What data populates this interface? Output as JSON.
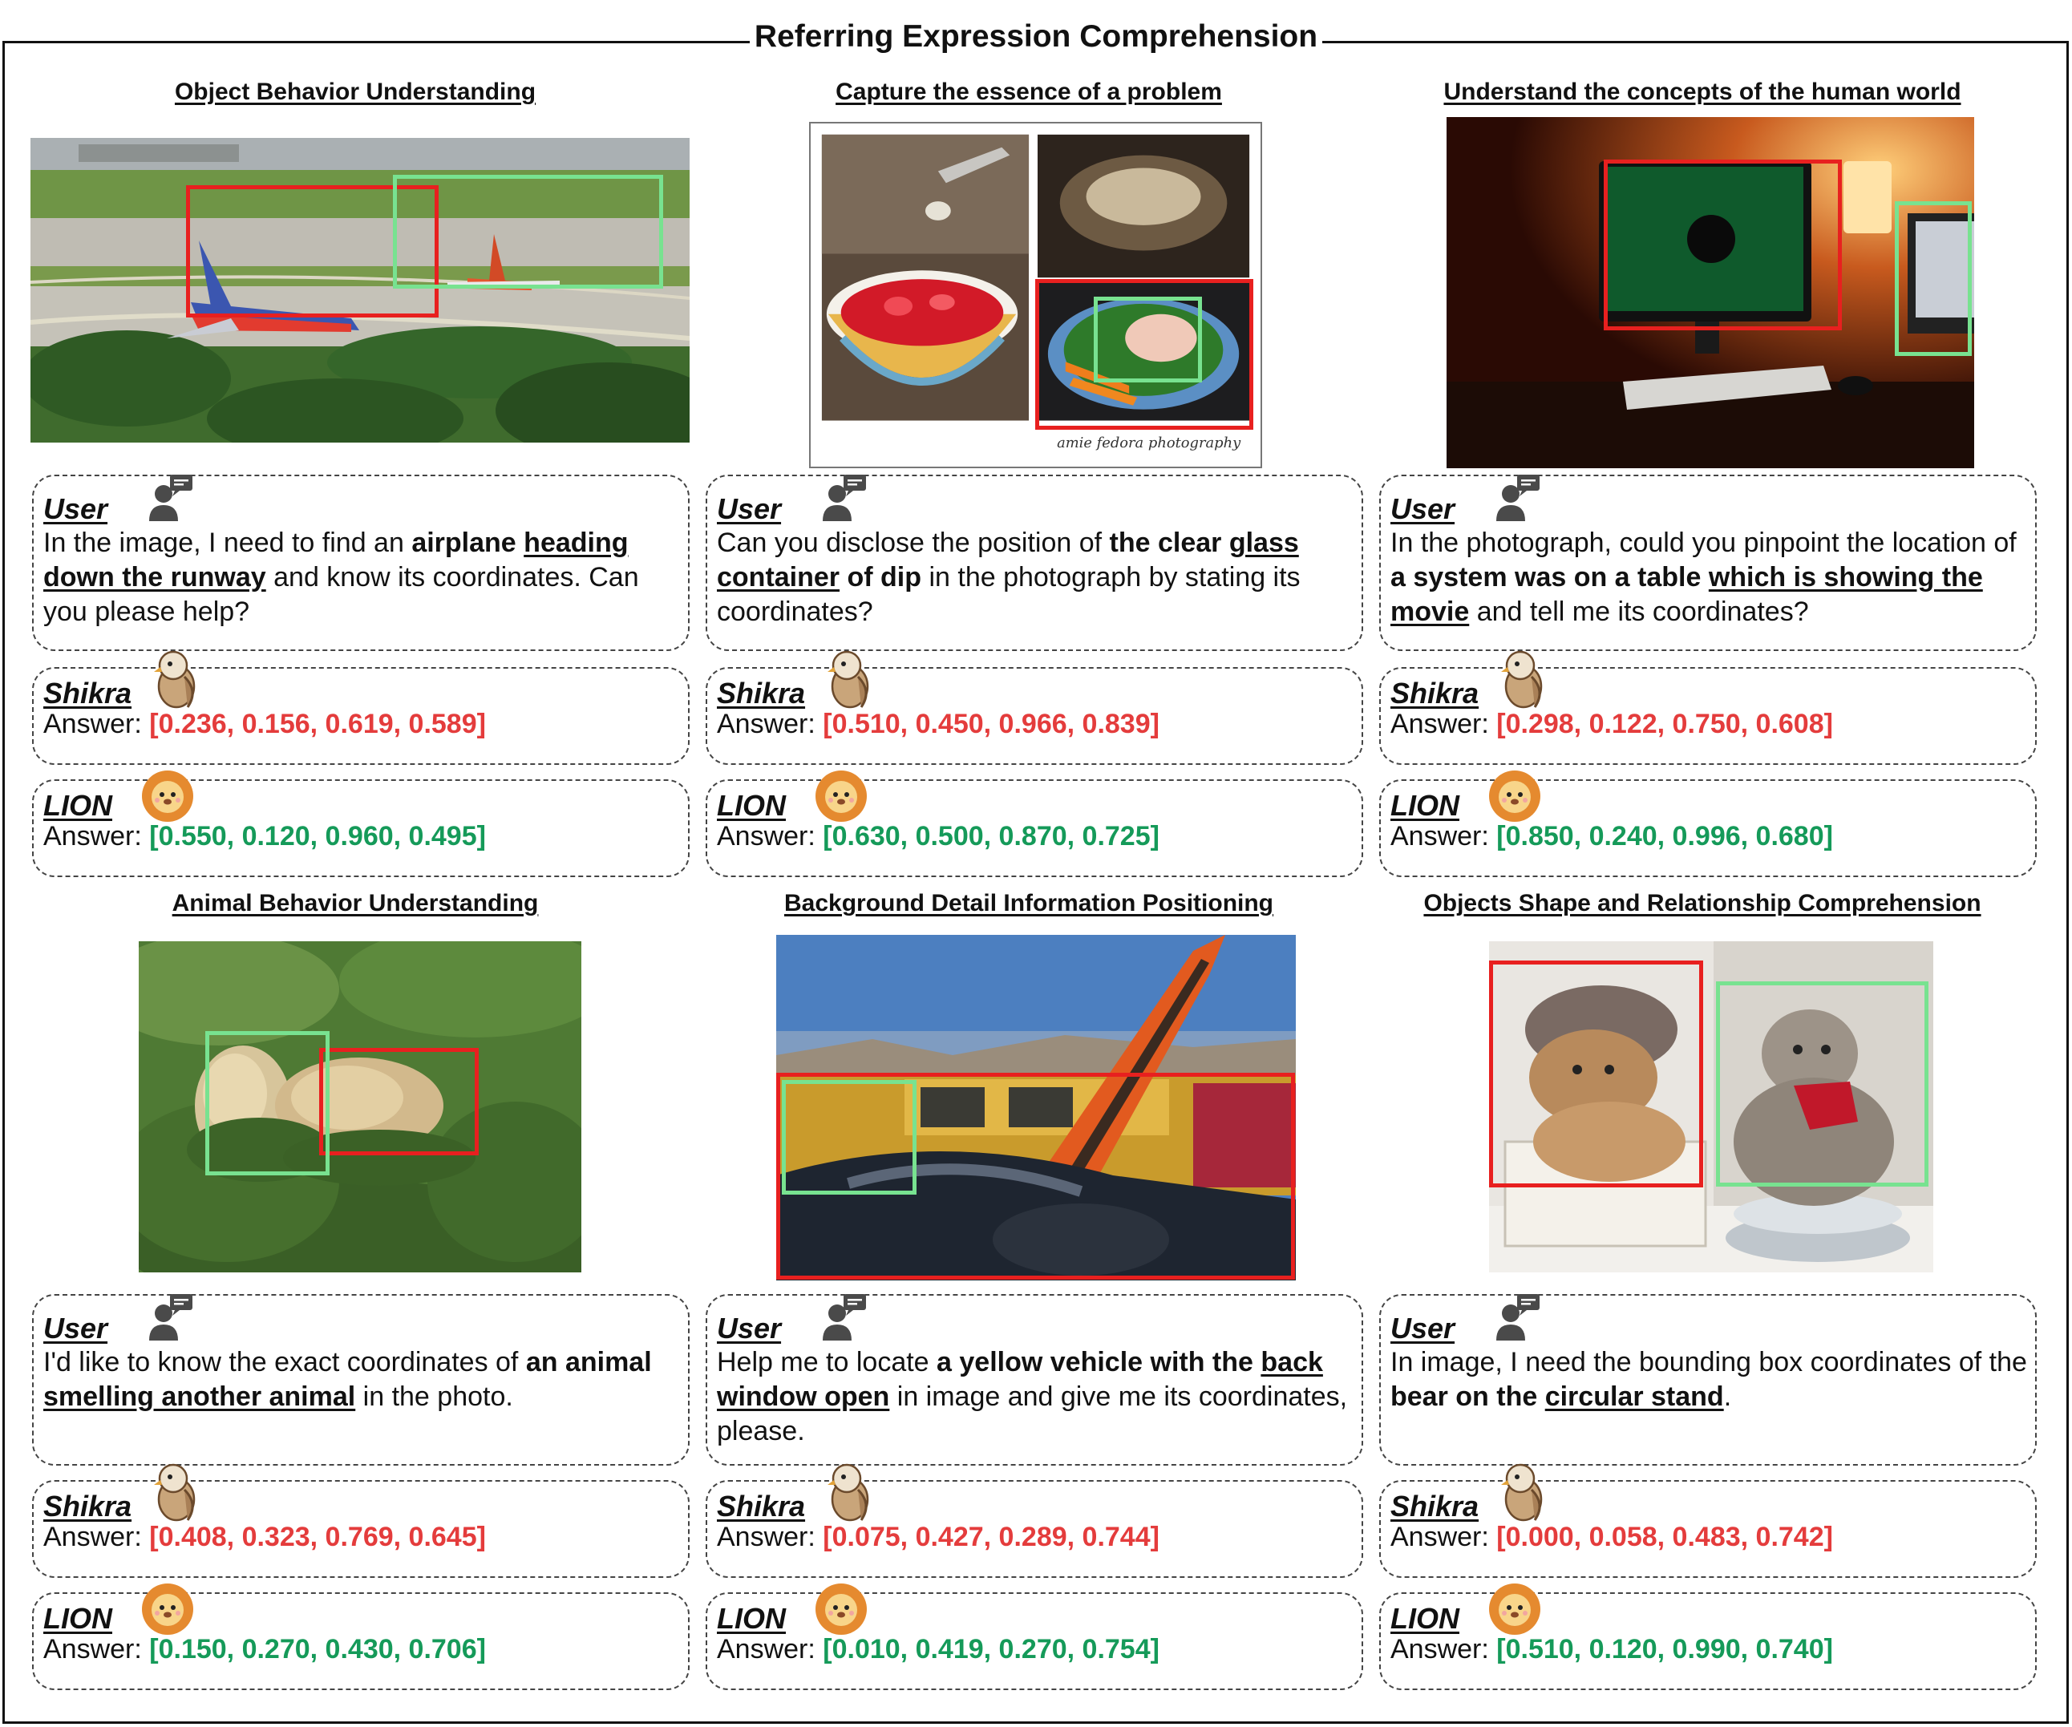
{
  "title": "Referring Expression Comprehension",
  "labels": {
    "user": "User",
    "shikra": "Shikra",
    "lion": "LION",
    "answer_prefix": "Answer:"
  },
  "colors": {
    "shikra_box": "#e8201f",
    "lion_box": "#78e290",
    "shikra_text": "#e43c3c",
    "lion_text": "#159a59"
  },
  "panels": [
    {
      "heading": "Object Behavior Understanding",
      "image": "airport-airplanes-photo",
      "question": [
        {
          "t": "In the image, I need to find an "
        },
        {
          "t": "airplane",
          "b": true
        },
        {
          "t": " "
        },
        {
          "t": "heading down the runway",
          "b": true,
          "u": true
        },
        {
          "t": " and know its coordinates. Can you please help?"
        }
      ],
      "shikra_answer": "[0.236, 0.156, 0.619, 0.589]",
      "lion_answer": "[0.550, 0.120, 0.960, 0.495]"
    },
    {
      "heading": "Capture the essence of a problem",
      "image": "food-collage-photo",
      "watermark": "amie fedora photography",
      "question": [
        {
          "t": "Can you disclose the position of "
        },
        {
          "t": "the clear ",
          "b": true
        },
        {
          "t": "glass container",
          "b": true,
          "u": true
        },
        {
          "t": " of dip",
          "b": true
        },
        {
          "t": " in the photograph by stating its coordinates?"
        }
      ],
      "shikra_answer": "[0.510, 0.450, 0.966, 0.839]",
      "lion_answer": "[0.630, 0.500, 0.870, 0.725]"
    },
    {
      "heading": "Understand the concepts of the human world",
      "image": "computer-desk-photo",
      "question": [
        {
          "t": "In the photograph, could you pinpoint the location of "
        },
        {
          "t": "a system was on a table ",
          "b": true
        },
        {
          "t": "which is showing the movie",
          "b": true,
          "u": true
        },
        {
          "t": " and tell me its coordinates?"
        }
      ],
      "shikra_answer": "[0.298, 0.122, 0.750, 0.608]",
      "lion_answer": "[0.850, 0.240, 0.996, 0.680]"
    },
    {
      "heading": "Animal Behavior Understanding",
      "image": "bears-in-bushes-photo",
      "question": [
        {
          "t": "I'd like to know the exact coordinates of "
        },
        {
          "t": "an animal",
          "b": true
        },
        {
          "t": " "
        },
        {
          "t": "smelling another animal",
          "b": true,
          "u": true
        },
        {
          "t": " in the photo."
        }
      ],
      "shikra_answer": "[0.408, 0.323, 0.769, 0.645]",
      "lion_answer": "[0.150, 0.270, 0.430, 0.706]"
    },
    {
      "heading": "Background Detail Information Positioning",
      "image": "surfboard-cars-photo",
      "question": [
        {
          "t": "Help me to locate "
        },
        {
          "t": "a yellow vehicle with the ",
          "b": true
        },
        {
          "t": "back window open",
          "b": true,
          "u": true
        },
        {
          "t": " in image and give me its coordinates, please."
        }
      ],
      "shikra_answer": "[0.075, 0.427, 0.289, 0.744]",
      "lion_answer": "[0.010, 0.419, 0.270, 0.754]"
    },
    {
      "heading": "Objects Shape and Relationship Comprehension",
      "image": "teddy-bears-photo",
      "question": [
        {
          "t": "In image, I need the bounding box coordinates of the "
        },
        {
          "t": "bear on the ",
          "b": true
        },
        {
          "t": "circular stand",
          "b": true,
          "u": true
        },
        {
          "t": "."
        }
      ],
      "shikra_answer": "[0.000, 0.058, 0.483, 0.742]",
      "lion_answer": "[0.510, 0.120, 0.990, 0.740]"
    }
  ]
}
